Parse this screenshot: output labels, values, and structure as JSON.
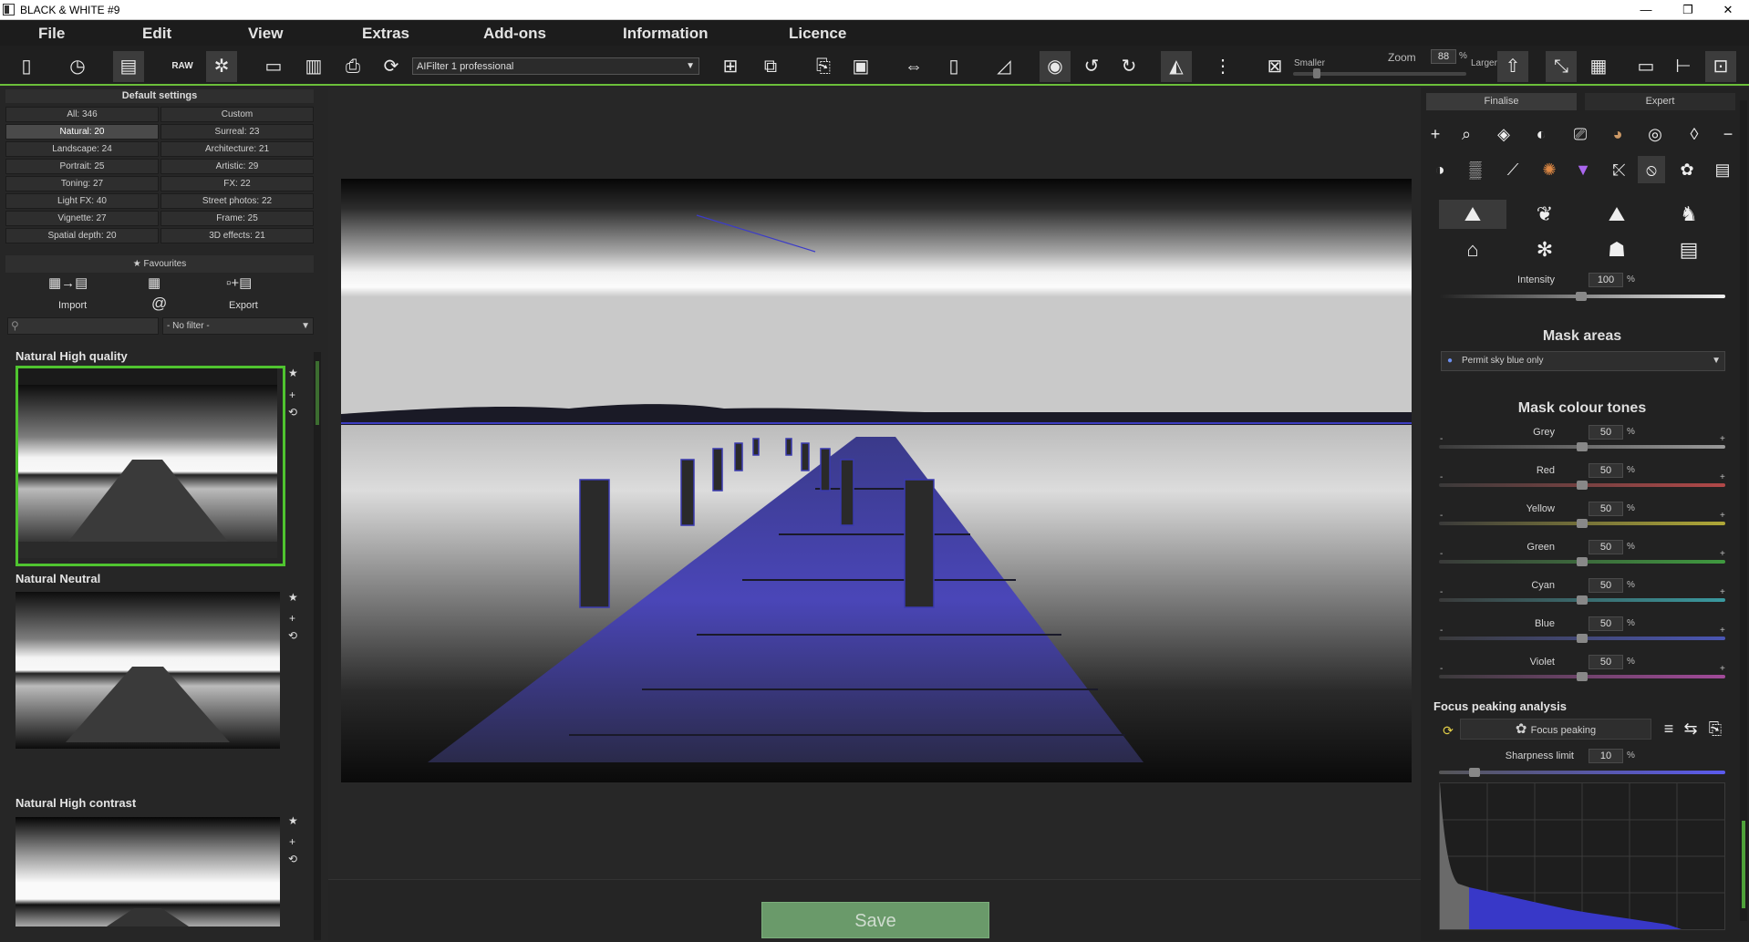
{
  "window": {
    "title": "BLACK & WHITE #9",
    "controls": [
      "—",
      "❐",
      "✕"
    ]
  },
  "menu": [
    "File",
    "Edit",
    "View",
    "Extras",
    "Add-ons",
    "Information",
    "Licence"
  ],
  "toolbar": {
    "filter_select": "AIFilter 1 professional",
    "zoom_label": "Zoom",
    "zoom_value": "88",
    "zoom_unit": "%",
    "smaller_label": "Smaller",
    "larger_label": "Larger",
    "raw_label": "RAW"
  },
  "left": {
    "header": "Default settings",
    "categories": [
      [
        "All: 346",
        "Custom"
      ],
      [
        "Natural: 20",
        "Surreal: 23"
      ],
      [
        "Landscape: 24",
        "Architecture: 21"
      ],
      [
        "Portrait: 25",
        "Artistic: 29"
      ],
      [
        "Toning: 27",
        "FX: 22"
      ],
      [
        "Light FX: 40",
        "Street photos: 22"
      ],
      [
        "Vignette: 27",
        "Frame: 25"
      ],
      [
        "Spatial depth: 20",
        "3D effects: 21"
      ]
    ],
    "favourites": "Favourites",
    "import_label": "Import",
    "export_label": "Export",
    "at_symbol": "@",
    "filter_value": "- No filter -",
    "presets": [
      "Natural High quality",
      "Natural Neutral",
      "Natural High contrast"
    ]
  },
  "center": {
    "save_label": "Save"
  },
  "right": {
    "tabs": [
      "Finalise",
      "Expert"
    ],
    "intensity_label": "Intensity",
    "intensity_value": "100",
    "pct": "%",
    "mask_areas_title": "Mask areas",
    "mask_areas_value": "Permit sky blue only",
    "mask_tones_title": "Mask colour tones",
    "tones": [
      {
        "label": "Grey",
        "value": "50",
        "color": "#9a9a9a"
      },
      {
        "label": "Red",
        "value": "50",
        "color": "#b24848"
      },
      {
        "label": "Yellow",
        "value": "50",
        "color": "#b0a838"
      },
      {
        "label": "Green",
        "value": "50",
        "color": "#3f9a3f"
      },
      {
        "label": "Cyan",
        "value": "50",
        "color": "#3a9aa0"
      },
      {
        "label": "Blue",
        "value": "50",
        "color": "#4a56b4"
      },
      {
        "label": "Violet",
        "value": "50",
        "color": "#a24a9a"
      }
    ],
    "focus_title": "Focus peaking analysis",
    "focus_button": "Focus peaking",
    "sharpness_label": "Sharpness limit",
    "sharpness_value": "10",
    "minus": "-",
    "plus": "+"
  },
  "colors": {
    "accent_green": "#4fc42f",
    "peaking_blue": "#3a3acc"
  }
}
